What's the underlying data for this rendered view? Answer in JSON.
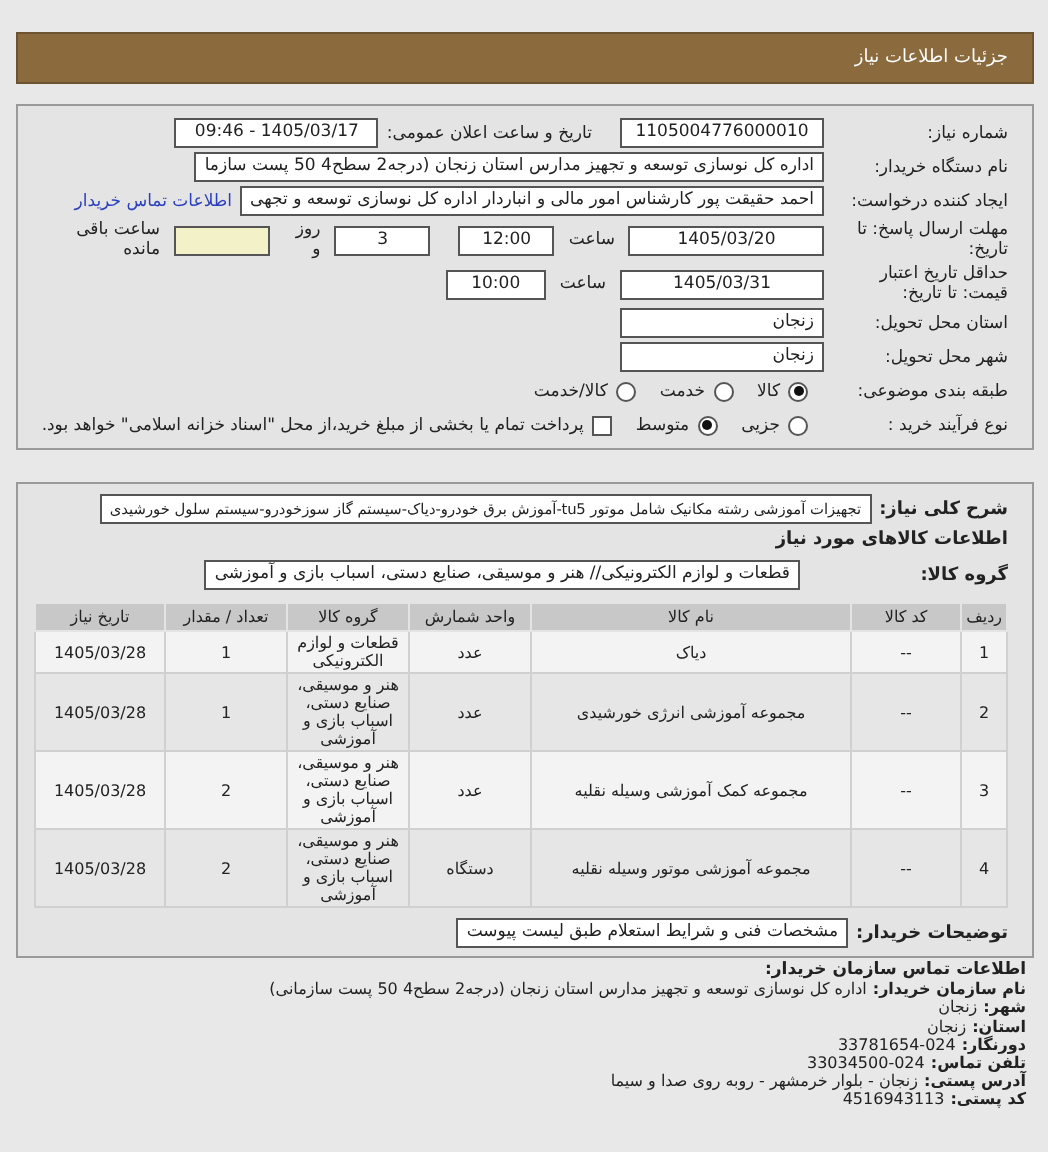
{
  "header": {
    "title": "جزئیات اطلاعات نیاز"
  },
  "need_number": {
    "label": "شماره نیاز:",
    "value": "1105004776000010"
  },
  "announce": {
    "label": "تاریخ و ساعت اعلان عمومی:",
    "value": "1405/03/17 - 09:46"
  },
  "buyer": {
    "label": "نام دستگاه خریدار:",
    "value": "اداره کل نوسازی   توسعه و تجهیز مدارس استان زنجان (درجه2  سطح4  50 پست سازما"
  },
  "requester": {
    "label": "ایجاد کننده درخواست:",
    "value": "احمد حقیقت پور کارشناس امور مالی و انباردار اداره کل نوسازی   توسعه و تجهی",
    "link": "اطلاعات تماس خریدار"
  },
  "deadline": {
    "label": "مهلت ارسال پاسخ: تا تاریخ:",
    "date": "1405/03/20",
    "time_label": "ساعت",
    "time": "12:00",
    "days": "3",
    "days_label": "روز و",
    "hours_label": "ساعت باقی مانده"
  },
  "validity": {
    "label": "حداقل تاریخ اعتبار قیمت: تا تاریخ:",
    "date": "1405/03/31",
    "time_label": "ساعت",
    "time": "10:00"
  },
  "province": {
    "label": "استان محل تحویل:",
    "value": "زنجان"
  },
  "city": {
    "label": "شهر محل تحویل:",
    "value": "زنجان"
  },
  "category": {
    "label": "طبقه بندی موضوعی:",
    "options": [
      {
        "label": "کالا",
        "selected": true
      },
      {
        "label": "خدمت",
        "selected": false
      },
      {
        "label": "کالا/خدمت",
        "selected": false
      }
    ]
  },
  "process": {
    "label": "نوع فرآیند خرید :",
    "options": [
      {
        "label": "جزیی",
        "selected": false
      },
      {
        "label": "متوسط",
        "selected": true
      }
    ],
    "payment": {
      "checked": false,
      "text": "پرداخت تمام یا بخشی از مبلغ خرید،از محل \"اسناد خزانه اسلامی\" خواهد بود."
    }
  },
  "description": {
    "label": "شرح کلی نیاز:",
    "value": "تجهیزات آموزشی رشته مکانیک شامل موتور tu5-آموزش برق خودرو-دیاک-سیستم گاز سوزخودرو-سیستم سلول خورشیدی"
  },
  "items_heading": "اطلاعات کالاهای مورد نیاز",
  "goods_group": {
    "label": "گروه کالا:",
    "value": "قطعات و لوازم الکترونیکی// هنر و موسیقی، صنایع دستی، اسباب بازی و آموزشی"
  },
  "table": {
    "columns": [
      "ردیف",
      "کد کالا",
      "نام کالا",
      "واحد شمارش",
      "گروه کالا",
      "تعداد / مقدار",
      "تاریخ نیاز"
    ],
    "rows": [
      [
        "1",
        "--",
        "دیاک",
        "عدد",
        "قطعات و لوازم الکترونیکی",
        "1",
        "1405/03/28"
      ],
      [
        "2",
        "--",
        "مجموعه آموزشی انرژی خورشیدی",
        "عدد",
        "هنر و موسیقی، صنایع دستی، اسباب بازی و آموزشی",
        "1",
        "1405/03/28"
      ],
      [
        "3",
        "--",
        "مجموعه کمک آموزشی وسیله نقلیه",
        "عدد",
        "هنر و موسیقی، صنایع دستی، اسباب بازی و آموزشی",
        "2",
        "1405/03/28"
      ],
      [
        "4",
        "--",
        "مجموعه آموزشی موتور وسیله نقلیه",
        "دستگاه",
        "هنر و موسیقی، صنایع دستی، اسباب بازی و آموزشی",
        "2",
        "1405/03/28"
      ]
    ]
  },
  "buyer_notes": {
    "label": "توضیحات خریدار:",
    "value": "مشخصات فنی و شرایط استعلام طبق لیست پیوست"
  },
  "contact": {
    "title": "اطلاعات تماس سازمان خریدار:",
    "lines": [
      {
        "label": "نام سازمان خریدار:",
        "value": "اداره کل نوسازی توسعه و تجهیز مدارس استان زنجان (درجه2 سطح4 50 پست سازمانی)"
      },
      {
        "label": "شهر:",
        "value": "زنجان"
      },
      {
        "label": "استان:",
        "value": "زنجان"
      },
      {
        "label": "دورنگار:",
        "value": "024-33781654"
      },
      {
        "label": "تلفن تماس:",
        "value": "024-33034500"
      },
      {
        "label": "آدرس پستی:",
        "value": "زنجان - بلوار خرمشهر - روبه روی صدا و سیما"
      },
      {
        "label": "کد پستی:",
        "value": "4516943113"
      }
    ]
  }
}
